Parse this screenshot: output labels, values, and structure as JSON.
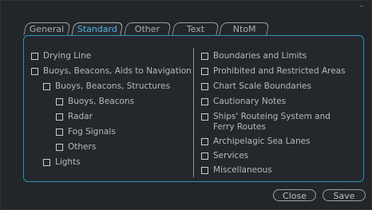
{
  "window": {
    "minimize_label": "–"
  },
  "tabs": [
    {
      "label": "General"
    },
    {
      "label": "Standard"
    },
    {
      "label": "Other"
    },
    {
      "label": "Text"
    },
    {
      "label": "NtoM"
    }
  ],
  "left_items": [
    {
      "label": "Drying Line",
      "checked": false
    },
    {
      "label": "Buoys, Beacons, Aids to Navigation",
      "checked": false
    },
    {
      "label": "Buoys, Beacons, Structures",
      "checked": false
    },
    {
      "label": "Buoys, Beacons",
      "checked": false
    },
    {
      "label": "Radar",
      "checked": false
    },
    {
      "label": "Fog Signals",
      "checked": false
    },
    {
      "label": "Others",
      "checked": false
    },
    {
      "label": "Lights",
      "checked": false
    }
  ],
  "right_items": [
    {
      "label": "Boundaries and Limits",
      "checked": false
    },
    {
      "label": "Prohibited and Restricted Areas",
      "checked": false
    },
    {
      "label": "Chart Scale Boundaries",
      "checked": false
    },
    {
      "label": "Cautionary Notes",
      "checked": false
    },
    {
      "label": "Ships' Routeing System and Ferry Routes",
      "checked": false
    },
    {
      "label": "Archipelagic Sea Lanes",
      "checked": false
    },
    {
      "label": "Services",
      "checked": false
    },
    {
      "label": "Miscellaneous",
      "checked": false
    }
  ],
  "buttons": {
    "close_label": "Close",
    "save_label": "Save"
  }
}
